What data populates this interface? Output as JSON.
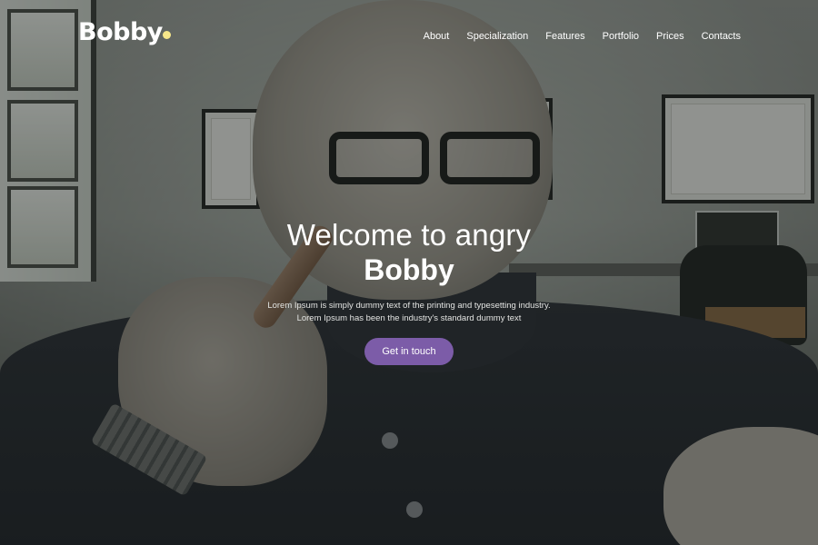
{
  "brand": {
    "name": "Bobby",
    "dot_color": "#f7e78a"
  },
  "nav": {
    "items": [
      {
        "label": "About"
      },
      {
        "label": "Specialization"
      },
      {
        "label": "Features"
      },
      {
        "label": "Portfolio"
      },
      {
        "label": "Prices"
      },
      {
        "label": "Contacts"
      }
    ]
  },
  "hero": {
    "headline_line1": "Welcome to angry",
    "headline_line2": "Bobby",
    "description_line1": "Lorem Ipsum is simply dummy text of the printing and typesetting industry.",
    "description_line2": "Lorem Ipsum has been the industry's standard dummy text",
    "cta_label": "Get in touch",
    "cta_color": "#7c5ca8"
  }
}
